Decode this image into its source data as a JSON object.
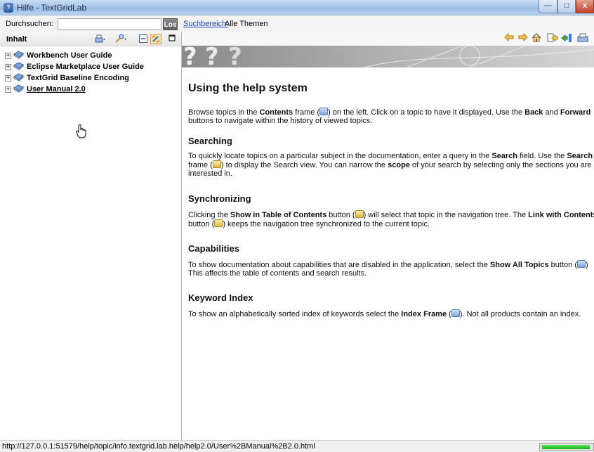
{
  "window": {
    "title": "Hilfe - TextGridLab",
    "app_icon": "help-app-icon",
    "controls": {
      "minimize": "—",
      "maximize": "□",
      "close": "x"
    }
  },
  "searchbar": {
    "label": "Durchsuchen:",
    "input_value": "",
    "go_label": "Los",
    "scope_link": "Suchbereich:",
    "scope_value": "Alle Themen"
  },
  "contents": {
    "title": "Inhalt",
    "toolbar_icons": [
      "print-dropdown-icon",
      "search-selected-topic-icon",
      "collapse-all-icon",
      "link-with-contents-icon",
      "maximize-icon"
    ],
    "items": [
      {
        "label": "Workbench User Guide",
        "expander": "+"
      },
      {
        "label": "Eclipse Marketplace User Guide",
        "expander": "+"
      },
      {
        "label": "TextGrid Baseline Encoding",
        "expander": "+"
      },
      {
        "label": "User Manual 2.0",
        "expander": "+"
      }
    ]
  },
  "bottom_tabs": [
    "contents-tab",
    "index-tab",
    "search-tab",
    "bookmarks-tab"
  ],
  "topic_toolbar_icons": [
    "back-icon",
    "forward-icon",
    "home-icon",
    "show-in-toc-icon",
    "bookmark-icon",
    "print-icon"
  ],
  "article": {
    "title": "Using the help system",
    "sections": [
      {
        "id": "intro",
        "heading": "",
        "parts": [
          "Browse topics in the ",
          "Contents",
          " frame (",
          "",
          ") on the left. Click on a topic to have it displayed. Use the ",
          "Back",
          " and ",
          "Forward",
          " buttons to navigate within the history of viewed topics."
        ]
      },
      {
        "id": "searching",
        "heading": "Searching",
        "parts": [
          "To quickly locate topics on a particular subject in the documentation, enter a query in the ",
          "Search",
          " field. Use the ",
          "Search",
          " frame (",
          "",
          ") to display the Search view. You can narrow the ",
          "scope",
          " of your search by selecting only the sections you are interested in."
        ]
      },
      {
        "id": "synchronizing",
        "heading": "Synchronizing",
        "parts": [
          "Clicking the ",
          "Show in Table of Contents",
          " button (",
          "",
          ") will select that topic in the navigation tree. The ",
          "Link with Contents",
          " button (",
          "",
          ") keeps the navigation tree synchronized to the current topic."
        ]
      },
      {
        "id": "capabilities",
        "heading": "Capabilities",
        "parts": [
          "To show documentation about capabilities that are disabled in the application, select the ",
          "Show All Topics",
          " button (",
          "",
          ") This affects the table of contents and search results."
        ]
      },
      {
        "id": "keyword",
        "heading": "Keyword Index",
        "parts": [
          "To show an alphabetically sorted index of keywords select the ",
          "Index Frame",
          " (",
          "",
          "). Not all products contain an index."
        ]
      }
    ]
  },
  "statusbar": {
    "url": "http://127.0.0.1:51579/help/topic/info.textgrid.lab.help/help2.0/User%2BManual%2B2.0.html",
    "progress": 0.95
  }
}
